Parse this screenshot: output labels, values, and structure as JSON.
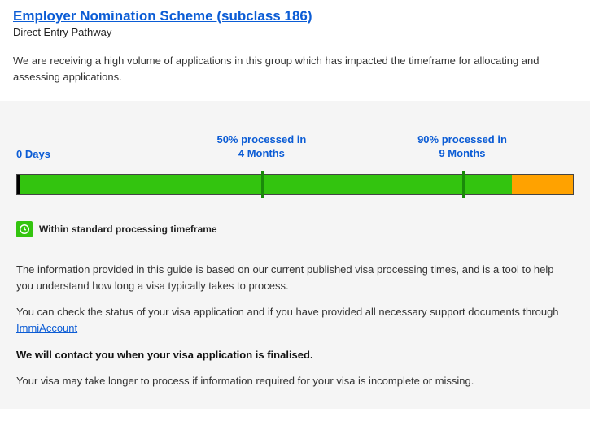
{
  "header": {
    "title": "Employer Nomination Scheme (subclass 186)",
    "subtitle": "Direct Entry Pathway"
  },
  "intro_text": "We are receiving a high volume of applications in this group which has impacted the timeframe for allocating and assessing applications.",
  "timeline": {
    "start_label": "0 Days",
    "mid_label_line1": "50% processed in",
    "mid_label_line2": "4 Months",
    "end_label_line1": "90% processed in",
    "end_label_line2": "9 Months",
    "green_percent": 89,
    "orange_percent": 11,
    "tick_mid_percent": 44,
    "tick_end_percent": 80
  },
  "status_text": "Within standard processing timeframe",
  "info": {
    "para1": "The information provided in this guide is based on our current published visa processing times, and is a tool to help you understand how long a visa typically takes to process.",
    "para2_pre": "You can check the status of your visa application and if you have provided all necessary support documents through ",
    "para2_link": "ImmiAccount",
    "para3": "We will contact you when your visa application is finalised.",
    "para4": "Your visa may take longer to process if information required for your visa is incomplete or missing."
  }
}
